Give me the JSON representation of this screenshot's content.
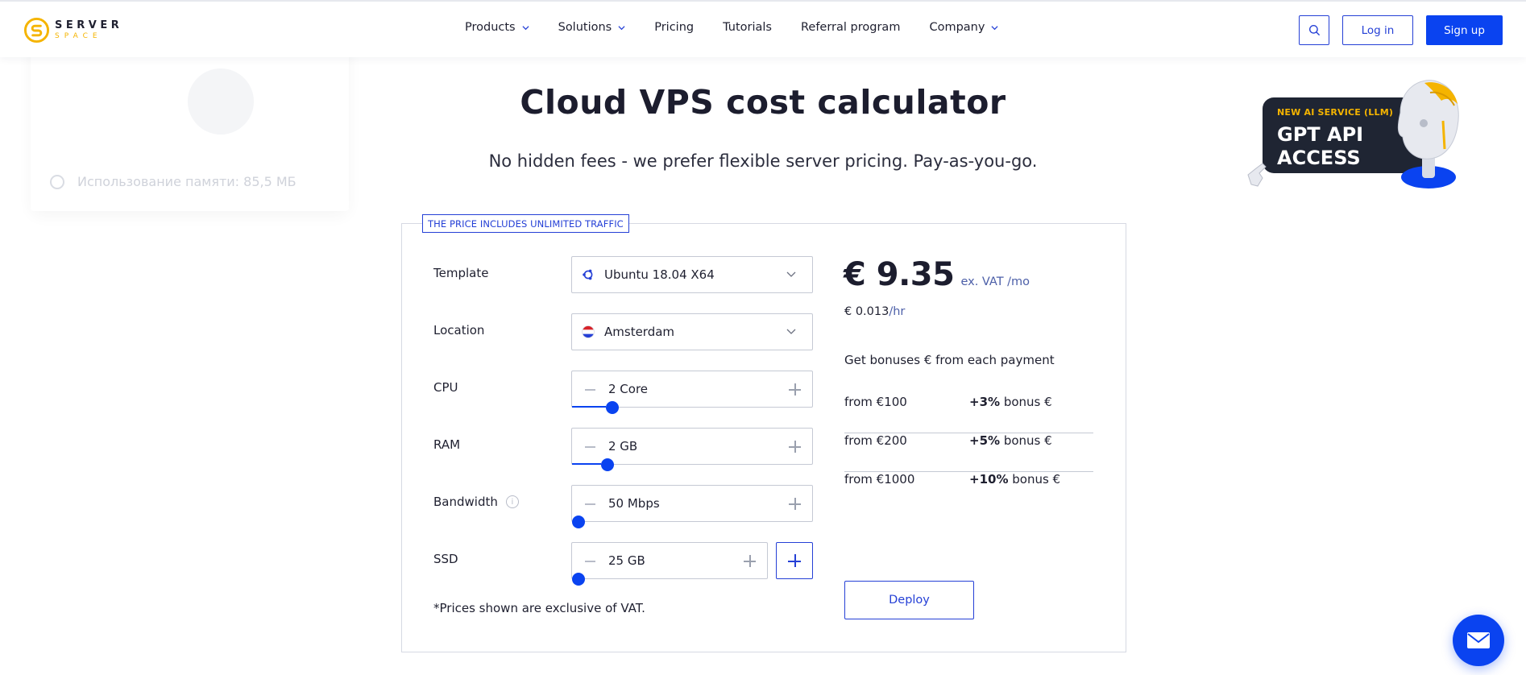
{
  "brand": {
    "line1": "SERVER",
    "line2": "SPACE",
    "accent": "#f5b400"
  },
  "nav": {
    "items": [
      {
        "label": "Products",
        "dropdown": true
      },
      {
        "label": "Solutions",
        "dropdown": true
      },
      {
        "label": "Pricing",
        "dropdown": false
      },
      {
        "label": "Tutorials",
        "dropdown": false
      },
      {
        "label": "Referral program",
        "dropdown": false
      },
      {
        "label": "Company",
        "dropdown": true
      }
    ],
    "login_label": "Log in",
    "signup_label": "Sign up",
    "search_icon": "search-icon"
  },
  "background_card": {
    "text": "Использование памяти: 85,5 МБ"
  },
  "hero": {
    "title": "Cloud VPS cost calculator",
    "subtitle": "No hidden fees - we prefer flexible server pricing. Pay-as-you-go."
  },
  "promo": {
    "tag": "NEW AI SERVICE (LLM)",
    "title_line1": "GPT API",
    "title_line2": "ACCESS"
  },
  "calculator": {
    "traffic_tag": "THE PRICE INCLUDES UNLIMITED TRAFFIC",
    "template": {
      "label": "Template",
      "value": "Ubuntu 18.04 X64",
      "icon": "ubuntu-icon"
    },
    "location": {
      "label": "Location",
      "value": "Amsterdam",
      "icon": "netherlands-flag-icon"
    },
    "cpu": {
      "label": "CPU",
      "value": "2 Core",
      "slider_fraction": 0.14
    },
    "ram": {
      "label": "RAM",
      "value": "2 GB",
      "slider_fraction": 0.12
    },
    "bandwidth": {
      "label": "Bandwidth",
      "value": "50 Mbps",
      "slider_fraction": 0.0,
      "info_icon": "info-icon"
    },
    "ssd": {
      "label": "SSD",
      "value": "25 GB",
      "slider_fraction": 0.0
    },
    "vat_note": "*Prices shown are exclusive of VAT.",
    "price": {
      "main": "€ 9.35",
      "suffix": "ex. VAT /mo",
      "hourly_value": "€ 0.013",
      "hourly_unit": "/hr"
    },
    "bonus_heading": "Get bonuses € from each payment",
    "bonuses": [
      {
        "from": "from €100",
        "percent": "+3%",
        "rest": " bonus €"
      },
      {
        "from": "from €200",
        "percent": "+5%",
        "rest": " bonus €"
      },
      {
        "from": "from €1000",
        "percent": "+10%",
        "rest": " bonus €"
      }
    ],
    "deploy_label": "Deploy"
  },
  "colors": {
    "primary": "#0a43f0",
    "outline": "#2540d6",
    "text": "#1f2030"
  }
}
